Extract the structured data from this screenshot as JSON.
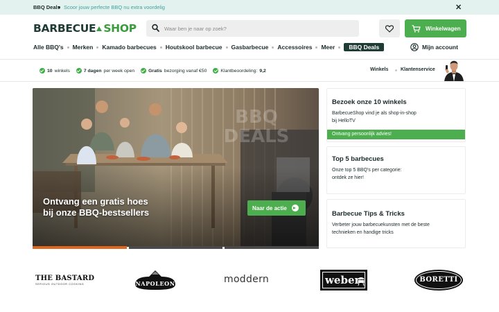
{
  "topbar": {
    "title": "BBQ Deals",
    "promo": "Scoor jouw perfecte BBQ nu extra voordelig",
    "close": "✕"
  },
  "header": {
    "logo_part1": "BARBECUE",
    "logo_part2": "SHOP",
    "search_placeholder": "Waar ben je naar op zoek?",
    "cart_label": "Winkelwagen"
  },
  "nav": {
    "items": [
      "Alle BBQ's",
      "Merken",
      "Kamado barbecues",
      "Houtskool barbecue",
      "Gasbarbecue",
      "Accessoires",
      "Meer"
    ],
    "deals_label": "BBQ Deals",
    "account_label": "Mijn account"
  },
  "usp": {
    "u1_bold": "10",
    "u1_text": "winkels",
    "u2_bold": "7 dagen",
    "u2_text": "per week open",
    "u3_bold": "Gratis",
    "u3_text": "bezorging vanaf €50",
    "u4_text": "Klantbeoordeling:",
    "u4_bold": "9,2",
    "stores_link": "Winkels",
    "service_link": "Klantenservice"
  },
  "hero": {
    "title_line1": "Ontvang een gratis hoes",
    "title_line2": "bij onze BBQ-bestsellers",
    "cta_label": "Naar de actie",
    "watermark_line1": "BBQ",
    "watermark_line2": "DEALS",
    "slides_active": 1,
    "slides_total": 3
  },
  "cards": [
    {
      "title": "Bezoek onze 10 winkels",
      "text": "BarbecueShop vind je als shop-in-shop bij HelloTV",
      "strip": "Ontvang persoonlijk advies!"
    },
    {
      "title": "Top 5 barbecues",
      "text": "Onze top 5 BBQ's per categorie: ontdek ze hier!"
    },
    {
      "title": "Barbecue Tips & Tricks",
      "text": "Verbeter jouw barbecuekunsten met de beste technieken en handige tricks"
    }
  ],
  "brands": {
    "bastard": "THE BASTARD",
    "bastard_sub": "SERIOUS OUTDOOR COOKING",
    "napoleon": "NAPOLEON",
    "moddern": "moddern",
    "weber": "weber",
    "boretti": "BORETTI"
  },
  "colors": {
    "brand_green": "#4cae4f",
    "dark_green": "#1e3c34",
    "active_slide": "#e1661e",
    "topbar_bg": "#e3f1ef"
  },
  "icons": [
    "search-icon",
    "heart-icon",
    "cart-icon",
    "user-icon",
    "check-icon",
    "close-icon",
    "arrow-right-icon"
  ]
}
